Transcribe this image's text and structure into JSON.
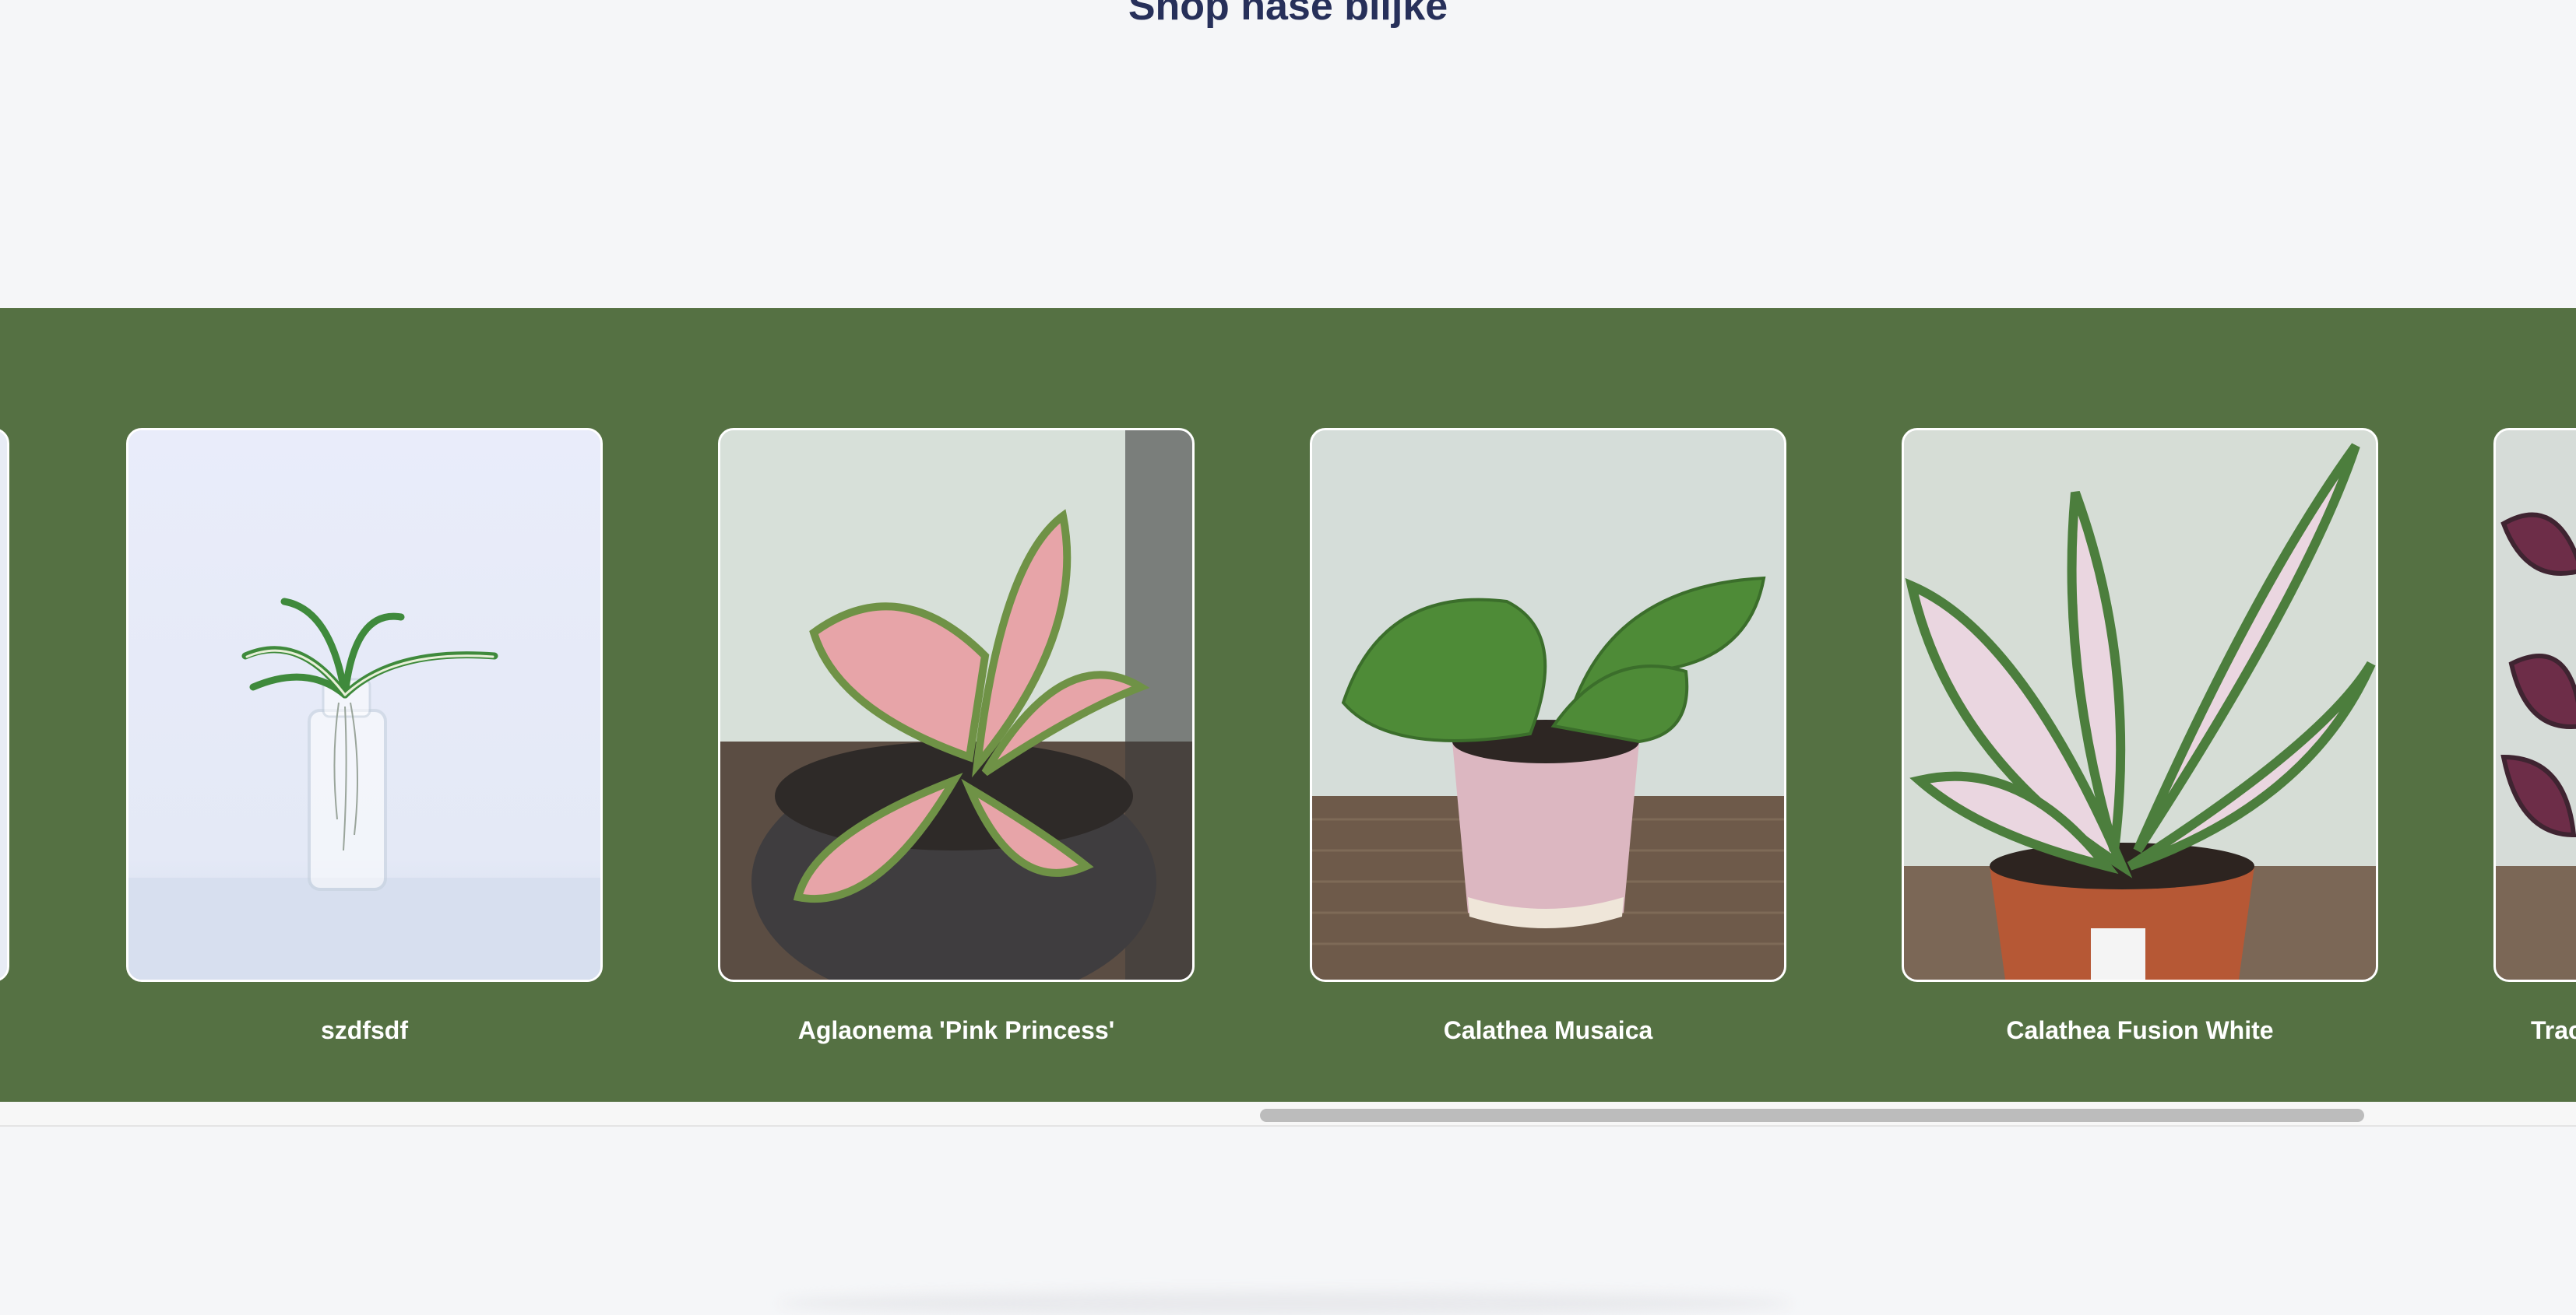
{
  "section": {
    "title": "Shop naše biljke"
  },
  "carousel": {
    "background_color": "#557143",
    "items": [
      {
        "name": ""
      },
      {
        "name": "szdfsdf"
      },
      {
        "name": "Aglaonema 'Pink Princess'"
      },
      {
        "name": "Calathea Musaica"
      },
      {
        "name": "Calathea Fusion White"
      },
      {
        "name": "Trac"
      }
    ]
  },
  "scrollbar": {
    "track_color": "#f7f7f7",
    "thumb_color": "#bcbcbc"
  }
}
